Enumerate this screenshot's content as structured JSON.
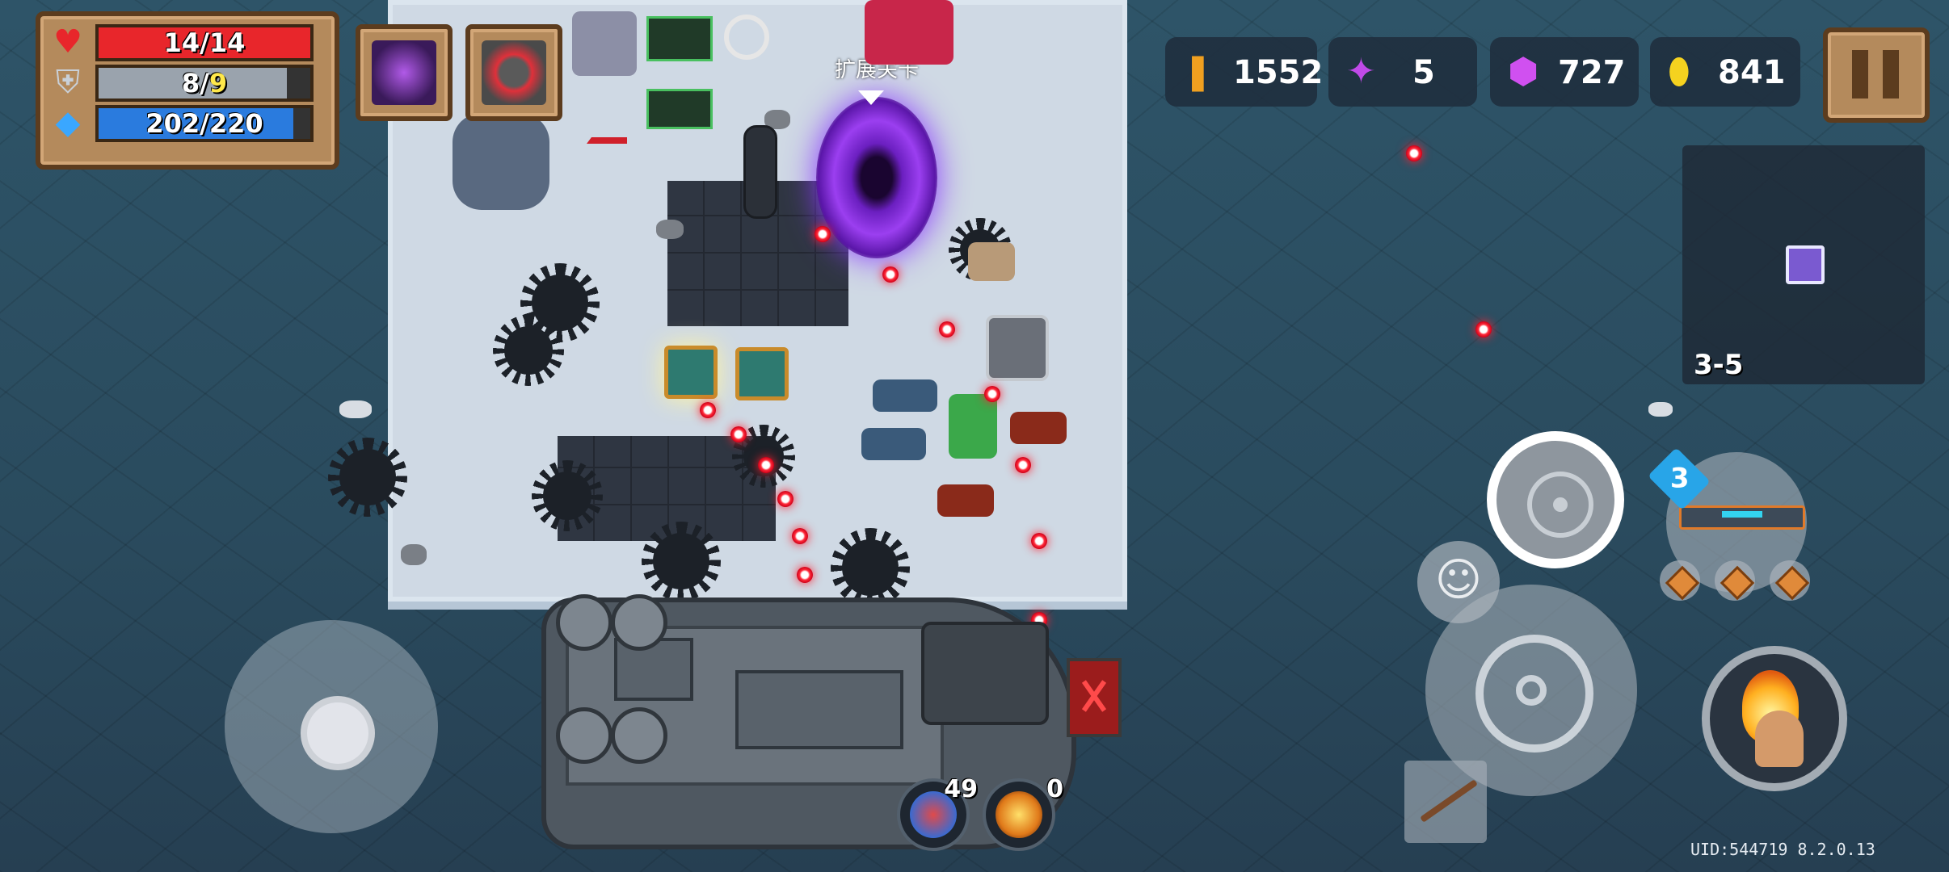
{
  "status": {
    "health": {
      "current": "14",
      "max": "14",
      "label": "14/14",
      "fraction": 1.0
    },
    "armor": {
      "current": "8",
      "max": "9",
      "fraction": 0.89
    },
    "energy": {
      "current": "202",
      "max": "220",
      "label": "202/220",
      "fraction": 0.918
    }
  },
  "currencies": [
    {
      "icon": "bullet-material-icon",
      "value": "1552"
    },
    {
      "icon": "purple-gem-icon",
      "value": "5"
    },
    {
      "icon": "purple-token-icon",
      "value": "727"
    },
    {
      "icon": "gold-coin-icon",
      "value": "841"
    }
  ],
  "portal": {
    "label": "扩展关卡"
  },
  "minimap": {
    "level": "3-5"
  },
  "weapon": {
    "energy_cost": "3"
  },
  "abilities": [
    {
      "name": "skill-one",
      "count": "49"
    },
    {
      "name": "skill-two",
      "count": "0"
    }
  ],
  "footer": {
    "uid": "UID:544719 8.2.0.13"
  },
  "colors": {
    "health": "#e8262b",
    "armor": "#9aa3ad",
    "energy": "#2a7bde",
    "accent_wood": "#b48a5c"
  }
}
